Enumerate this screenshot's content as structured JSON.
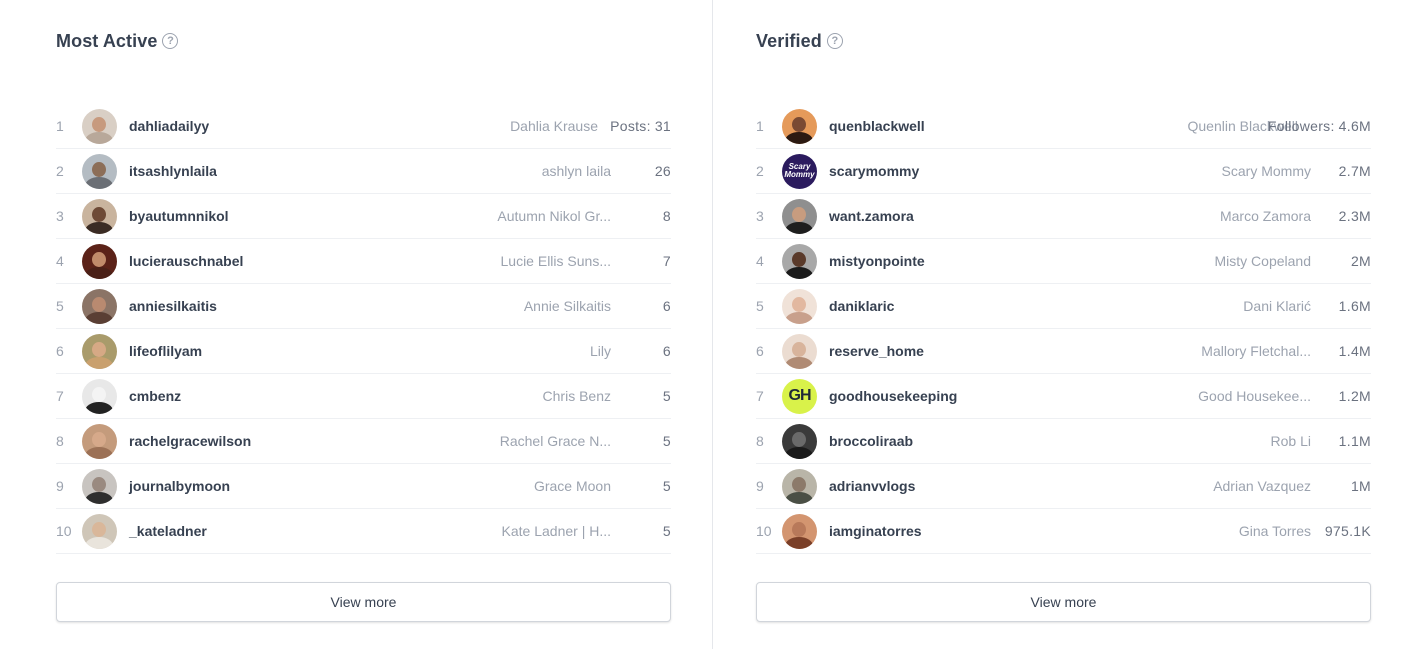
{
  "most_active": {
    "title": "Most Active",
    "help_icon": "question-circle-icon",
    "stat_label": "Posts:",
    "view_more": "View more",
    "rows": [
      {
        "rank": "1",
        "handle": "dahliadailyy",
        "name": "Dahlia Krause",
        "value": "31",
        "skin": "#c79a7e",
        "shirt": "#b8a89a",
        "bg": "#d9cfc5"
      },
      {
        "rank": "2",
        "handle": "itsashlynlaila",
        "name": "ashlyn laila",
        "value": "26",
        "skin": "#8c6e58",
        "shirt": "#6b6f75",
        "bg": "#b4bcc3"
      },
      {
        "rank": "3",
        "handle": "byautumnnikol",
        "name": "Autumn Nikol Gr...",
        "value": "8",
        "skin": "#6e4a36",
        "shirt": "#3b2c24",
        "bg": "#c9b49e"
      },
      {
        "rank": "4",
        "handle": "lucierauschnabel",
        "name": "Lucie Ellis Suns...",
        "value": "7",
        "skin": "#c18b6a",
        "shirt": "#4a2017",
        "bg": "#5b2218"
      },
      {
        "rank": "5",
        "handle": "anniesilkaitis",
        "name": "Annie Silkaitis",
        "value": "6",
        "skin": "#b98a70",
        "shirt": "#5a3f34",
        "bg": "#8b7466"
      },
      {
        "rank": "6",
        "handle": "lifeoflilyam",
        "name": "Lily",
        "value": "6",
        "skin": "#d6a985",
        "shirt": "#c9a06e",
        "bg": "#a99b6b"
      },
      {
        "rank": "7",
        "handle": "cmbenz",
        "name": "Chris Benz",
        "value": "5",
        "skin": "#f4f4f4",
        "shirt": "#222222",
        "bg": "#e8e8e8"
      },
      {
        "rank": "8",
        "handle": "rachelgracewilson",
        "name": "Rachel Grace N...",
        "value": "5",
        "skin": "#d6a98a",
        "shirt": "#9c7156",
        "bg": "#c49b7c"
      },
      {
        "rank": "9",
        "handle": "journalbymoon",
        "name": "Grace Moon",
        "value": "5",
        "skin": "#9a8a80",
        "shirt": "#2e2e2e",
        "bg": "#c8c4c0"
      },
      {
        "rank": "10",
        "handle": "_kateladner",
        "name": "Kate Ladner | H...",
        "value": "5",
        "skin": "#d9b79a",
        "shirt": "#e9e4dc",
        "bg": "#cfc6b8"
      }
    ]
  },
  "verified": {
    "title": "Verified",
    "help_icon": "question-circle-icon",
    "stat_label": "Followers:",
    "view_more": "View more",
    "rows": [
      {
        "rank": "1",
        "handle": "quenblackwell",
        "name": "Quenlin Blackwell",
        "value": "4.6M",
        "skin": "#7a4a33",
        "shirt": "#2c1a12",
        "bg": "#e59a5a"
      },
      {
        "rank": "2",
        "handle": "scarymommy",
        "name": "Scary Mommy",
        "value": "2.7M",
        "skin": "",
        "shirt": "",
        "bg": "#2b1b5e",
        "mono_small": "Scary Mommy"
      },
      {
        "rank": "3",
        "handle": "want.zamora",
        "name": "Marco Zamora",
        "value": "2.3M",
        "skin": "#c79c7f",
        "shirt": "#1e1e1e",
        "bg": "#8f8f8f"
      },
      {
        "rank": "4",
        "handle": "mistyonpointe",
        "name": "Misty Copeland",
        "value": "2M",
        "skin": "#5a3a2a",
        "shirt": "#1b1b1b",
        "bg": "#a8a8a8"
      },
      {
        "rank": "5",
        "handle": "daniklaric",
        "name": "Dani Klarić",
        "value": "1.6M",
        "skin": "#e2b8a0",
        "shirt": "#c8a08c",
        "bg": "#f0e2d8"
      },
      {
        "rank": "6",
        "handle": "reserve_home",
        "name": "Mallory Fletchal...",
        "value": "1.4M",
        "skin": "#d8b49c",
        "shirt": "#b08b74",
        "bg": "#ebdcd1"
      },
      {
        "rank": "7",
        "handle": "goodhousekeeping",
        "name": "Good Housekee...",
        "value": "1.2M",
        "skin": "",
        "shirt": "",
        "bg": "#d9f24a",
        "mono": "GH"
      },
      {
        "rank": "8",
        "handle": "broccoliraab",
        "name": "Rob Li",
        "value": "1.1M",
        "skin": "#6a6a6a",
        "shirt": "#1a1a1a",
        "bg": "#3a3a3a"
      },
      {
        "rank": "9",
        "handle": "adrianvvlogs",
        "name": "Adrian Vazquez",
        "value": "1M",
        "skin": "#8c7a6a",
        "shirt": "#4a4f45",
        "bg": "#b9b5a8"
      },
      {
        "rank": "10",
        "handle": "iamginatorres",
        "name": "Gina Torres",
        "value": "975.1K",
        "skin": "#b8795a",
        "shirt": "#7a3f28",
        "bg": "#d39570"
      }
    ]
  }
}
